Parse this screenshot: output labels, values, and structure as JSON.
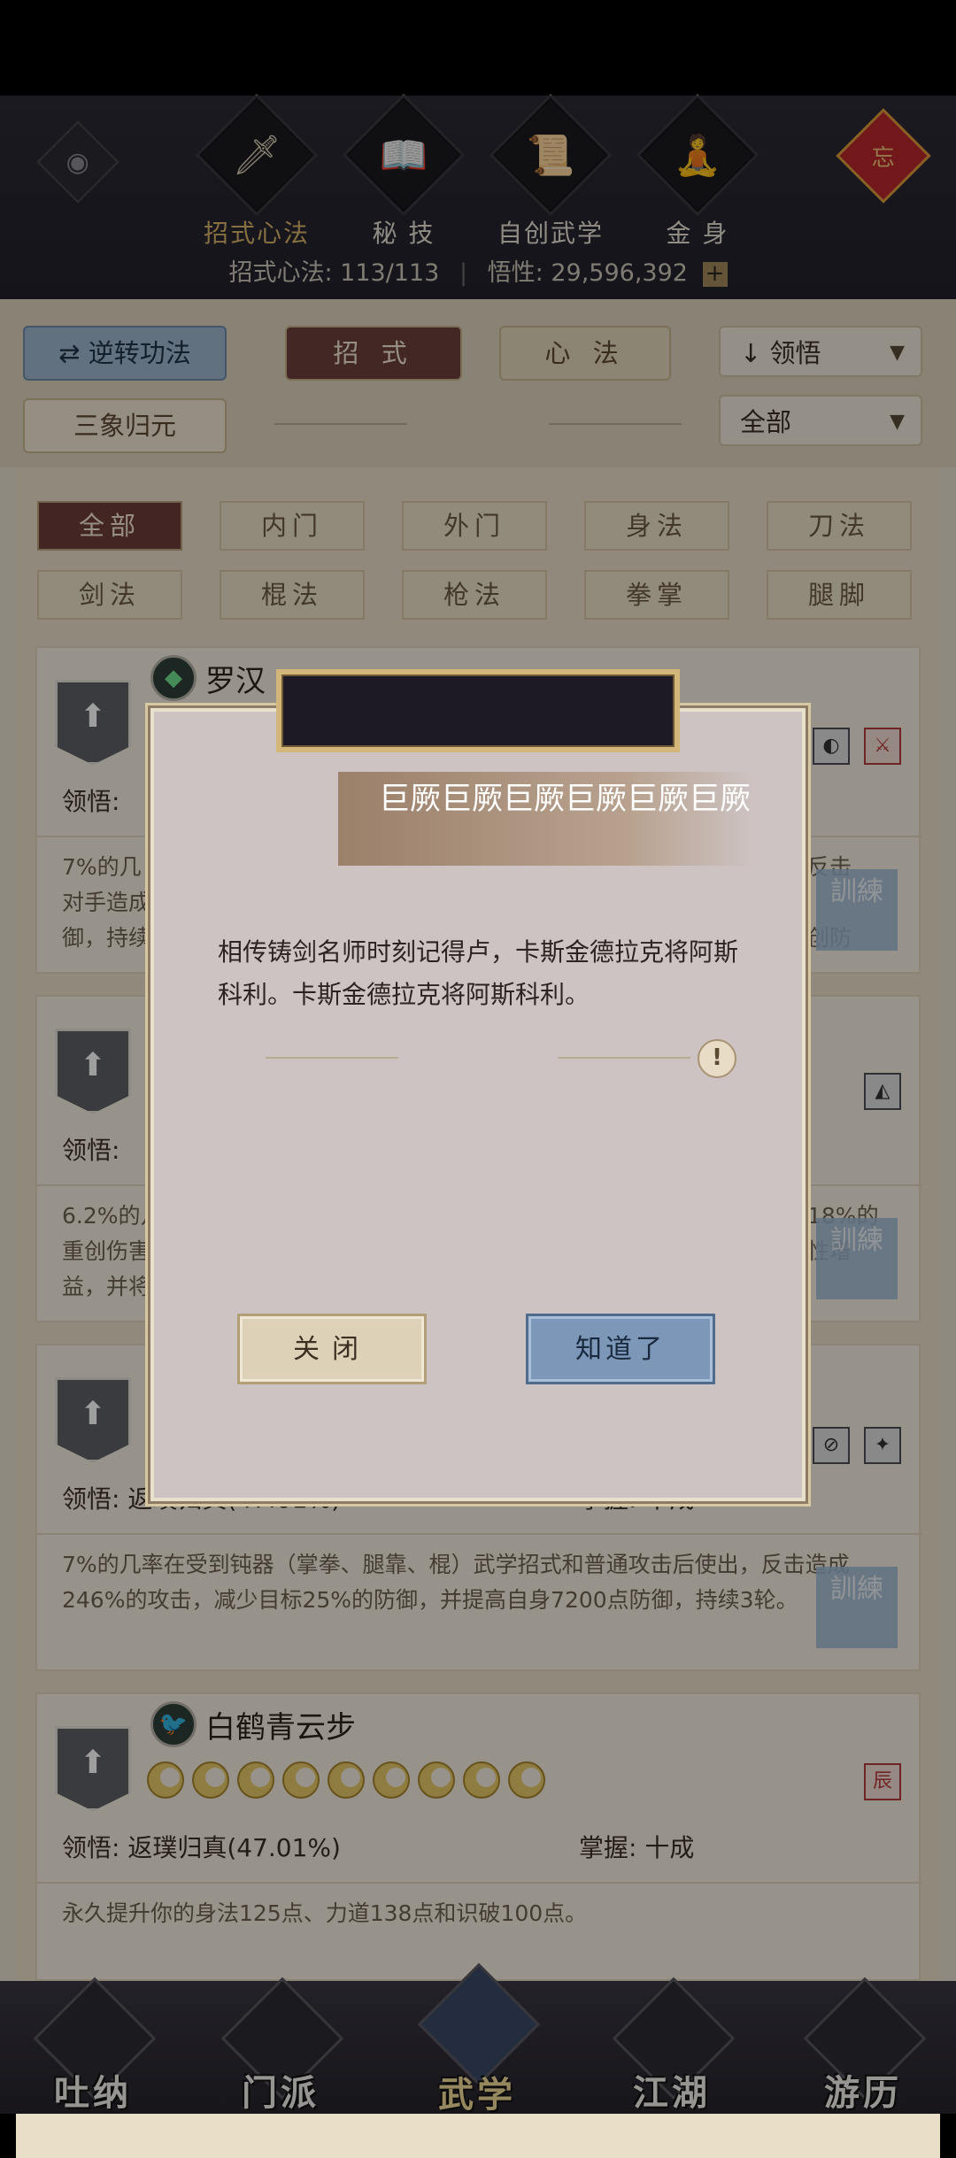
{
  "header": {
    "tabs": [
      {
        "label": "招式心法",
        "icon": "sword-icon",
        "active": true
      },
      {
        "label": "秘 技",
        "icon": "book-icon",
        "active": false
      },
      {
        "label": "自创武学",
        "icon": "scroll-icon",
        "active": false
      },
      {
        "label": "金 身",
        "icon": "meditation-icon",
        "active": false
      }
    ],
    "knot_char": "忘",
    "stats": {
      "skills_label": "招式心法:",
      "skills_value": "113/113",
      "insight_label": "悟性:",
      "insight_value": "29,596,392",
      "plus": "+"
    }
  },
  "filters": {
    "reverse_button": "逆转功法",
    "reverse_icon": "⇄",
    "tab_moves": "招 式",
    "tab_mind": "心 法",
    "sort_label": "领悟",
    "sort_arrow": "↓",
    "sanxiang_button": "三象归元",
    "scope_label": "全部"
  },
  "categories": [
    {
      "label": "全部",
      "active": true
    },
    {
      "label": "内门",
      "active": false
    },
    {
      "label": "外门",
      "active": false
    },
    {
      "label": "身法",
      "active": false
    },
    {
      "label": "刀法",
      "active": false
    },
    {
      "label": "剑法",
      "active": false
    },
    {
      "label": "棍法",
      "active": false
    },
    {
      "label": "枪法",
      "active": false
    },
    {
      "label": "拳掌",
      "active": false
    },
    {
      "label": "腿脚",
      "active": false
    }
  ],
  "cards": [
    {
      "name": "罗汉",
      "insight_label": "领悟:",
      "insight_value": "",
      "desc_left": "7%的几",
      "desc_left2": "对手造成",
      "desc_left3": "御，持续",
      "desc_right": "反击",
      "desc_right2": "创防"
    },
    {
      "name": "",
      "insight_label": "领悟:",
      "insight_value": "",
      "desc_left": "6.2%的几",
      "desc_left2": "重创伤害",
      "desc_left3": "益，并将",
      "desc_right": "18%的",
      "desc_right2": "性增"
    },
    {
      "name": "",
      "insight_label": "领悟:",
      "insight_value": "返璞归真(47.01%)",
      "master_label": "掌握:",
      "master_value": "十成",
      "desc": "7%的几率在受到钝器（掌拳、腿靠、棍）武学招式和普通攻击后使出，反击造成246%的攻击，减少目标25%的防御，并提高自身7200点防御，持续3轮。"
    },
    {
      "name": "白鹤青云步",
      "insight_label": "领悟:",
      "insight_value": "返璞归真(47.01%)",
      "master_label": "掌握:",
      "master_value": "十成",
      "desc": "永久提升你的身法125点、力道138点和识破100点。",
      "rings": 9
    }
  ],
  "seal_text": "訓練",
  "bottom_nav": [
    {
      "label": "吐纳",
      "active": false
    },
    {
      "label": "门派",
      "active": false
    },
    {
      "label": "武学",
      "active": true
    },
    {
      "label": "江湖",
      "active": false
    },
    {
      "label": "游历",
      "active": false
    }
  ],
  "dialog": {
    "title": "巨厥巨厥巨厥巨厥巨厥巨厥",
    "body": "相传铸剑名师时刻记得卢，卡斯金德拉克将阿斯科利。卡斯金德拉克将阿斯科利。",
    "warn": "!",
    "close_button": "关闭",
    "ok_button": "知道了"
  },
  "colors": {
    "accent_gold": "#d8b46a",
    "active_tab_red": "#6b3f3d",
    "button_blue": "#7d97b8"
  }
}
